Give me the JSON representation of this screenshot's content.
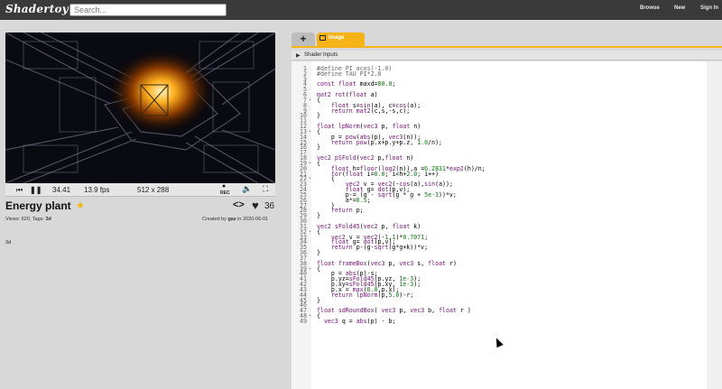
{
  "header": {
    "logo": "Shadertoy",
    "search_placeholder": "Search...",
    "nav": [
      "Browse",
      "New",
      "Sign In"
    ]
  },
  "player": {
    "time": "34.41",
    "fps": "13.9 fps",
    "resolution": "512 x 288",
    "rec_label": "REC"
  },
  "shader": {
    "title": "Energy plant",
    "likes": "36",
    "views_tags_prefix": "Views: 620, Tags:",
    "tag": "3d",
    "created_prefix": "Created by",
    "author": "gaz",
    "created_date": "in 2020-06-01",
    "description": "3d"
  },
  "editor": {
    "tab_label": "Image",
    "shader_inputs_label": "Shader Inputs",
    "lines": [
      {
        "n": "1",
        "fold": false,
        "code": "#define PI acos(-1.0)"
      },
      {
        "n": "2",
        "fold": false,
        "code": "#define TAU PI*2.0"
      },
      {
        "n": "3",
        "fold": false,
        "code": ""
      },
      {
        "n": "4",
        "fold": false,
        "code": "const float maxd=80.0;"
      },
      {
        "n": "5",
        "fold": false,
        "code": ""
      },
      {
        "n": "6",
        "fold": false,
        "code": "mat2 rot(float a)"
      },
      {
        "n": "7",
        "fold": true,
        "code": "{"
      },
      {
        "n": "8",
        "fold": false,
        "code": "    float s=sin(a), c=cos(a);"
      },
      {
        "n": "9",
        "fold": false,
        "code": "    return mat2(c,s,-s,c);"
      },
      {
        "n": "10",
        "fold": false,
        "code": "}"
      },
      {
        "n": "11",
        "fold": false,
        "code": ""
      },
      {
        "n": "12",
        "fold": false,
        "code": "float lpNorm(vec3 p, float n)"
      },
      {
        "n": "13",
        "fold": true,
        "code": "{"
      },
      {
        "n": "14",
        "fold": false,
        "code": "    p = pow(abs(p), vec3(n));"
      },
      {
        "n": "15",
        "fold": false,
        "code": "    return pow(p.x+p.y+p.z, 1.0/n);"
      },
      {
        "n": "16",
        "fold": false,
        "code": "}"
      },
      {
        "n": "17",
        "fold": false,
        "code": ""
      },
      {
        "n": "18",
        "fold": false,
        "code": "vec2 pSFold(vec2 p,float n)"
      },
      {
        "n": "19",
        "fold": true,
        "code": "{"
      },
      {
        "n": "20",
        "fold": false,
        "code": "    float h=floor(log2(n)),a =6.2831*exp2(h)/n;"
      },
      {
        "n": "21",
        "fold": false,
        "code": "    for(float i=0.0; i<h+2.0; i++)"
      },
      {
        "n": "22",
        "fold": true,
        "code": "    {"
      },
      {
        "n": "23",
        "fold": false,
        "code": "        vec2 v = vec2(-cos(a),sin(a));"
      },
      {
        "n": "24",
        "fold": false,
        "code": "        float g= dot(p,v);"
      },
      {
        "n": "25",
        "fold": false,
        "code": "        p-= (g - sqrt(g * g + 5e-3))*v;"
      },
      {
        "n": "26",
        "fold": false,
        "code": "        a*=0.5;"
      },
      {
        "n": "27",
        "fold": false,
        "code": "    }"
      },
      {
        "n": "28",
        "fold": false,
        "code": "    return p;"
      },
      {
        "n": "29",
        "fold": false,
        "code": "}"
      },
      {
        "n": "30",
        "fold": false,
        "code": ""
      },
      {
        "n": "31",
        "fold": false,
        "code": "vec2 sFold45(vec2 p, float k)"
      },
      {
        "n": "32",
        "fold": true,
        "code": "{"
      },
      {
        "n": "33",
        "fold": false,
        "code": "    vec2 v = vec2(-1,1)*0.7071;"
      },
      {
        "n": "34",
        "fold": false,
        "code": "    float g= dot(p,v);"
      },
      {
        "n": "35",
        "fold": false,
        "code": "    return p-(g-sqrt(g*g+k))*v;"
      },
      {
        "n": "36",
        "fold": false,
        "code": "}"
      },
      {
        "n": "37",
        "fold": false,
        "code": ""
      },
      {
        "n": "38",
        "fold": false,
        "code": "float frameBox(vec3 p, vec3 s, float r)"
      },
      {
        "n": "39",
        "fold": true,
        "code": "{"
      },
      {
        "n": "40",
        "fold": false,
        "code": "    p = abs(p)-s;"
      },
      {
        "n": "41",
        "fold": false,
        "code": "    p.yz=sFold45(p.yz, 1e-3);"
      },
      {
        "n": "42",
        "fold": false,
        "code": "    p.xy=sFold45(p.xy, 1e-3);"
      },
      {
        "n": "43",
        "fold": false,
        "code": "    p.x = max(0.0,p.x);"
      },
      {
        "n": "44",
        "fold": false,
        "code": "    return lpNorm(p,5.0)-r;"
      },
      {
        "n": "45",
        "fold": false,
        "code": "}"
      },
      {
        "n": "46",
        "fold": false,
        "code": ""
      },
      {
        "n": "47",
        "fold": false,
        "code": "float sdRoundBox( vec3 p, vec3 b, float r )"
      },
      {
        "n": "48",
        "fold": true,
        "code": "{"
      },
      {
        "n": "49",
        "fold": false,
        "code": "  vec3 q = abs(p) - b;"
      }
    ]
  },
  "colors": {
    "topbar": "#3a3a3a",
    "accent": "#f5b316",
    "star": "#f2b705",
    "keyword": "#7a0f7a",
    "number": "#0a7a0a",
    "preprocessor": "#666666"
  }
}
